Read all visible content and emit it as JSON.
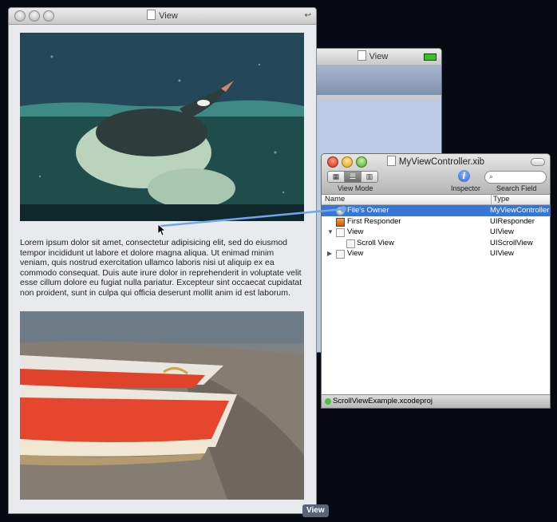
{
  "back_window": {
    "title": "View"
  },
  "main_window": {
    "title": "View",
    "paragraph": "Lorem ipsum dolor sit amet, consectetur adipisicing elit, sed do eiusmod tempor incididunt ut labore et dolore magna aliqua. Ut enimad minim veniam, quis nostrud exercitation ullamco laboris nisi ut aliquip ex ea commodo consequat. Duis aute irure dolor in reprehenderit in voluptate velit esse cillum dolore eu fugiat nulla pariatur. Excepteur sint occaecat cupidatat non proident, sunt in culpa qui officia deserunt mollit anim id est laborum.",
    "tag": "View"
  },
  "xib_window": {
    "title": "MyViewController.xib",
    "toolbar": {
      "view_mode_label": "View Mode",
      "inspector_label": "Inspector",
      "search_label": "Search Field",
      "search_value": ""
    },
    "columns": {
      "name": "Name",
      "type": "Type"
    },
    "rows": [
      {
        "name": "File's Owner",
        "type": "MyViewController"
      },
      {
        "name": "First Responder",
        "type": "UIResponder"
      },
      {
        "name": "View",
        "type": "UIView"
      },
      {
        "name": "Scroll View",
        "type": "UIScrollView"
      },
      {
        "name": "View",
        "type": "UIView"
      }
    ],
    "status": "ScrollViewExample.xcodeproj"
  },
  "colors": {
    "selection": "#3875d7",
    "connection": "#6fa6f0",
    "desktop": "#070a12"
  }
}
